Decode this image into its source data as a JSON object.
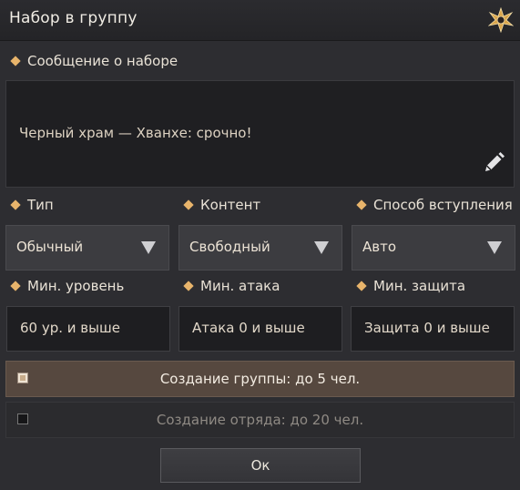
{
  "window": {
    "title": "Набор в группу",
    "emblem_icon": "gold-star-emblem-icon"
  },
  "message": {
    "label": "Сообщение о наборе",
    "value": "Черный храм — Хванхе: срочно!",
    "edit_icon": "pencil-icon"
  },
  "filters": {
    "type": {
      "label": "Тип",
      "value": "Обычный"
    },
    "content": {
      "label": "Контент",
      "value": "Свободный"
    },
    "join": {
      "label": "Способ вступления",
      "value": "Авто"
    }
  },
  "requirements": {
    "min_level": {
      "label": "Мин. уровень",
      "value": "60 ур. и выше"
    },
    "min_attack": {
      "label": "Мин. атака",
      "value": "Атака 0 и выше"
    },
    "min_defense": {
      "label": "Мин. защита",
      "value": "Защита 0 и выше"
    }
  },
  "options": {
    "group": {
      "label": "Создание группы: до 5 чел.",
      "checked": true
    },
    "squad": {
      "label": "Создание отряда: до 20 чел.",
      "checked": false
    }
  },
  "buttons": {
    "ok_label": "Ок"
  },
  "colors": {
    "accent": "#e8b46b",
    "panel": "#2d2d31",
    "active_option": "#56483f"
  }
}
